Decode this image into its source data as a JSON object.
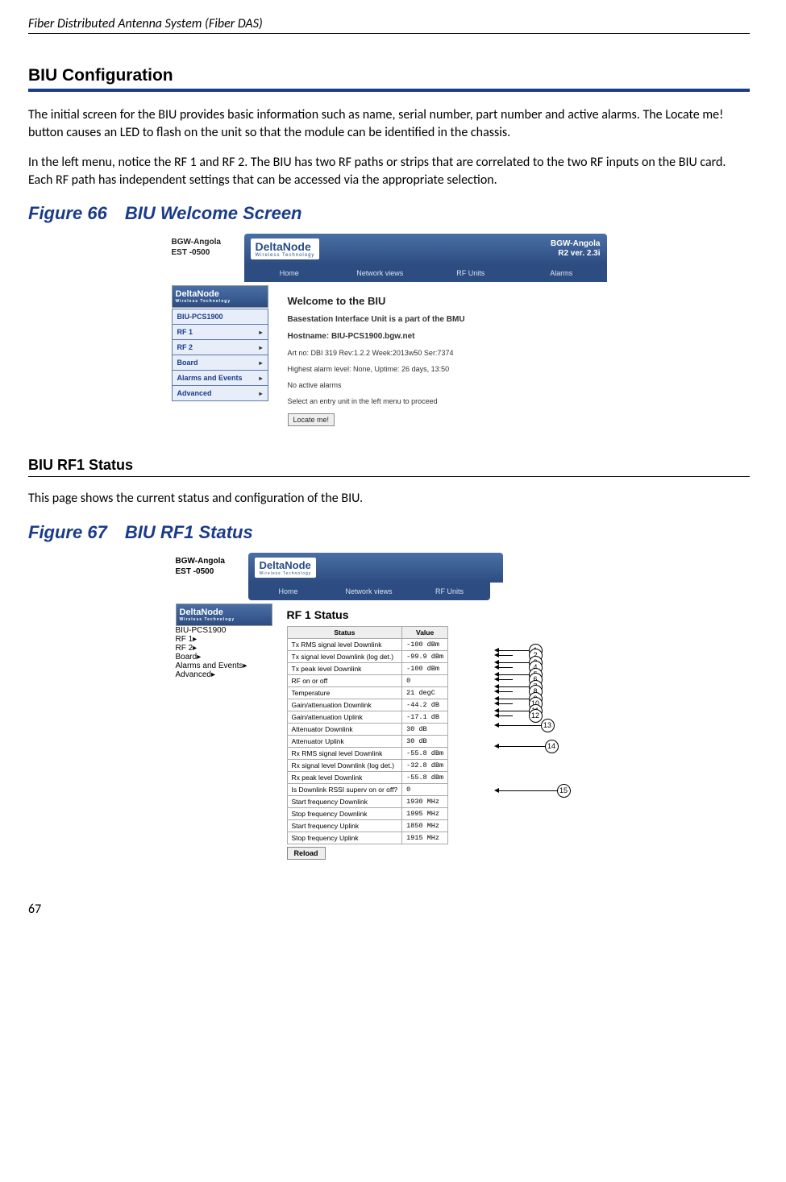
{
  "header": {
    "running_title": "Fiber Distributed Antenna System (Fiber DAS)"
  },
  "section1": {
    "heading": "BIU Configuration",
    "para1": "The initial screen for the BIU provides basic information such as name, serial number, part number and active alarms. The Locate me! button causes an LED to flash on the unit so that the module can be identified in the chassis.",
    "para2": "In the left menu, notice the RF 1 and RF 2. The BIU has two RF paths or strips that are correlated to the two RF inputs on the BIU card. Each RF path has independent settings that can be accessed via the appropriate selection."
  },
  "figure66": {
    "number": "Figure 66",
    "title": "BIU Welcome Screen"
  },
  "screenshot1": {
    "bgw_line1": "BGW-Angola",
    "bgw_line2": "EST -0500",
    "logo": "DeltaNode",
    "logo_sub": "Wireless Technology",
    "banner_right1": "BGW-Angola",
    "banner_right2": "R2 ver. 2.3i",
    "nav": [
      "Home",
      "Network views",
      "RF Units",
      "Alarms"
    ],
    "sidebar": [
      "BIU-PCS1900",
      "RF 1",
      "RF 2",
      "Board",
      "Alarms and Events",
      "Advanced"
    ],
    "welcome_title": "Welcome to the BIU",
    "line1": "Basestation Interface Unit is a part of the BMU",
    "line2": "Hostname: BIU-PCS1900.bgw.net",
    "line3": "Art no: DBI 319 Rev:1.2.2 Week:2013w50 Ser:7374",
    "line4": "Highest alarm level: None, Uptime: 26 days, 13:50",
    "line5": "No active alarms",
    "line6": "Select an entry unit in the left menu to proceed",
    "button": "Locate me!"
  },
  "section2": {
    "heading": "BIU RF1 Status",
    "para1": "This page shows the current status and configuration of the BIU."
  },
  "figure67": {
    "number": "Figure 67",
    "title": "BIU RF1 Status"
  },
  "screenshot2": {
    "bgw_line1": "BGW-Angola",
    "bgw_line2": "EST -0500",
    "logo": "DeltaNode",
    "logo_sub": "Wireless Technology",
    "nav": [
      "Home",
      "Network views",
      "RF Units"
    ],
    "sidebar": [
      "BIU-PCS1900",
      "RF 1",
      "RF 2",
      "Board",
      "Alarms and Events",
      "Advanced"
    ],
    "title": "RF 1 Status",
    "th_status": "Status",
    "th_value": "Value",
    "rows": [
      {
        "s": "Tx RMS signal level Downlink",
        "v": "-100 dBm"
      },
      {
        "s": "Tx signal level Downlink (log det.)",
        "v": "-99.9 dBm"
      },
      {
        "s": "Tx peak level Downlink",
        "v": "-100 dBm"
      },
      {
        "s": "RF on or off",
        "v": "0"
      },
      {
        "s": "Temperature",
        "v": "21 degC"
      },
      {
        "s": "Gain/attenuation Downlink",
        "v": "-44.2 dB"
      },
      {
        "s": "Gain/attenuation Uplink",
        "v": "-17.1 dB"
      },
      {
        "s": "Attenuator Downlink",
        "v": "30 dB"
      },
      {
        "s": "Attenuator Uplink",
        "v": "30 dB"
      },
      {
        "s": "Rx RMS signal level Downlink",
        "v": "-55.8 dBm"
      },
      {
        "s": "Rx signal level Downlink (log det.)",
        "v": "-32.8 dBm"
      },
      {
        "s": "Rx peak level Downlink",
        "v": "-55.8 dBm"
      },
      {
        "s": "Is Downlink RSSI superv on or off?",
        "v": "0"
      },
      {
        "s": "Start frequency Downlink",
        "v": "1930 MHz"
      },
      {
        "s": "Stop frequency Downlink",
        "v": "1995 MHz"
      },
      {
        "s": "Start frequency Uplink",
        "v": "1850 MHz"
      },
      {
        "s": "Stop frequency Uplink",
        "v": "1915 MHz"
      }
    ],
    "button": "Reload"
  },
  "page_number": "67"
}
